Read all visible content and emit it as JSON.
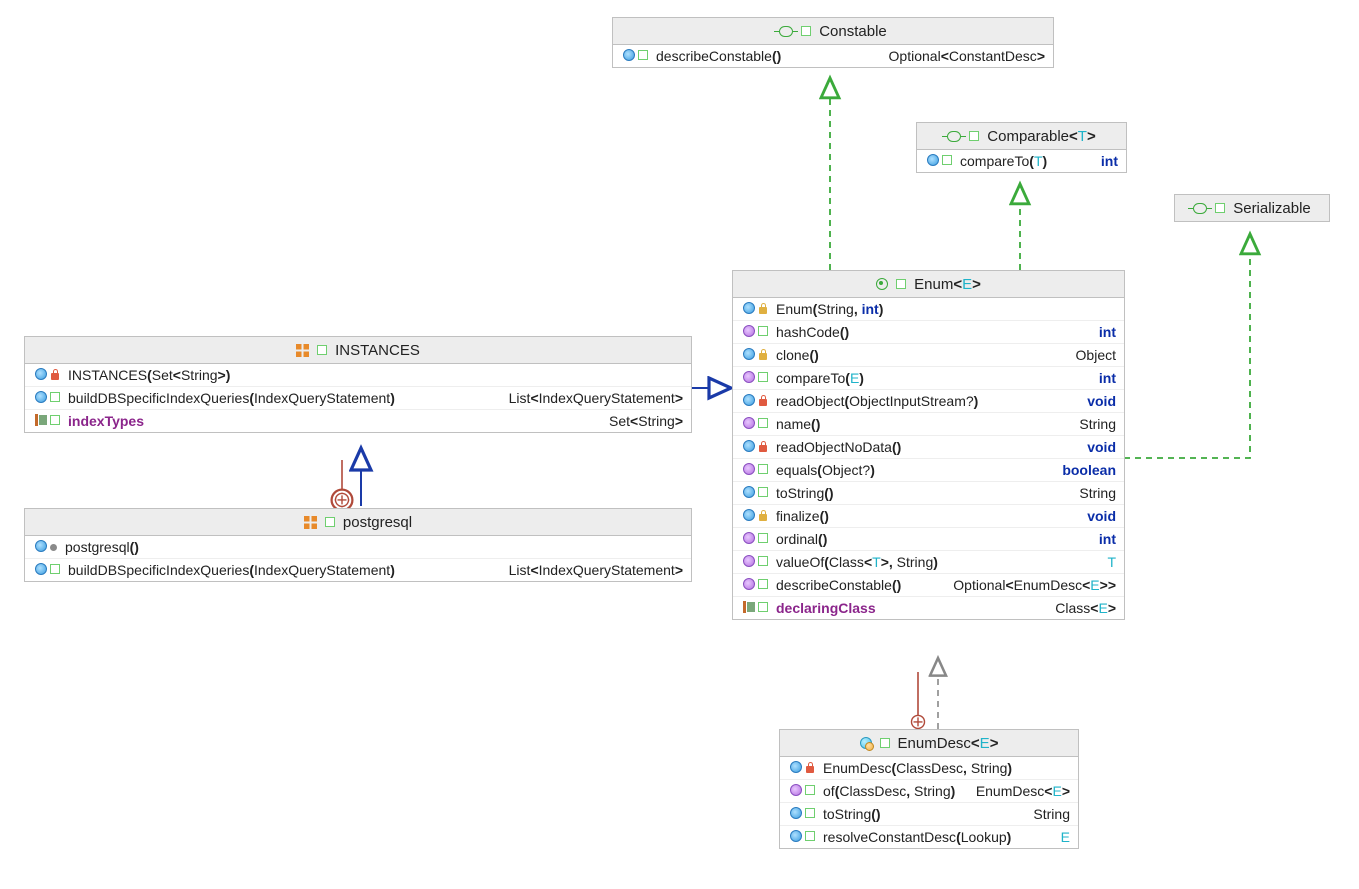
{
  "boxes": {
    "constable": {
      "title_html": "Constable",
      "members": [
        {
          "sig_html": "describeConstable<span class='punct'>()</span>",
          "ret_html": "Optional<span class='punct'>&lt;</span>ConstantDesc<span class='punct'>&gt;</span>"
        }
      ]
    },
    "comparable": {
      "title_html": "Comparable<span class='punct'>&lt;</span><span class='type-generic'>T</span><span class='punct'>&gt;</span>",
      "members": [
        {
          "sig_html": "compareTo<span class='punct'>(</span><span class='type-generic'>T</span><span class='punct'>)</span>",
          "ret_html": "<span class='kw'>int</span>"
        }
      ]
    },
    "serializable": {
      "title_html": "Serializable"
    },
    "enum": {
      "title_html": "Enum<span class='punct'>&lt;</span><span class='type-generic'>E</span><span class='punct'>&gt;</span>",
      "members": [
        {
          "icons": [
            "method-blue",
            "lock-yellow"
          ],
          "sig_html": "Enum<span class='punct'>(</span>String<span class='punct'>,</span> <span class='kw'>int</span><span class='punct'>)</span>",
          "ret_html": ""
        },
        {
          "icons": [
            "method-purple",
            "open"
          ],
          "sig_html": "hashCode<span class='punct'>()</span>",
          "ret_html": "<span class='kw'>int</span>"
        },
        {
          "icons": [
            "method-blue",
            "lock-yellow"
          ],
          "sig_html": "clone<span class='punct'>()</span>",
          "ret_html": "Object"
        },
        {
          "icons": [
            "method-purple",
            "open"
          ],
          "sig_html": "compareTo<span class='punct'>(</span><span class='type-generic'>E</span><span class='punct'>)</span>",
          "ret_html": "<span class='kw'>int</span>"
        },
        {
          "icons": [
            "method-blue",
            "lock"
          ],
          "sig_html": "readObject<span class='punct'>(</span>ObjectInputStream?<span class='punct'>)</span>",
          "ret_html": "<span class='kw'>void</span>"
        },
        {
          "icons": [
            "method-purple",
            "open"
          ],
          "sig_html": "name<span class='punct'>()</span>",
          "ret_html": "String"
        },
        {
          "icons": [
            "method-blue",
            "lock"
          ],
          "sig_html": "readObjectNoData<span class='punct'>()</span>",
          "ret_html": "<span class='kw'>void</span>"
        },
        {
          "icons": [
            "method-purple",
            "open"
          ],
          "sig_html": "equals<span class='punct'>(</span>Object?<span class='punct'>)</span>",
          "ret_html": "<span class='kw'>boolean</span>"
        },
        {
          "icons": [
            "method-blue",
            "open"
          ],
          "sig_html": "toString<span class='punct'>()</span>",
          "ret_html": "String"
        },
        {
          "icons": [
            "method-blue",
            "lock-yellow"
          ],
          "sig_html": "finalize<span class='punct'>()</span>",
          "ret_html": "<span class='kw'>void</span>"
        },
        {
          "icons": [
            "method-purple",
            "open"
          ],
          "sig_html": "ordinal<span class='punct'>()</span>",
          "ret_html": "<span class='kw'>int</span>"
        },
        {
          "icons": [
            "method-purple",
            "open"
          ],
          "sig_html": "valueOf<span class='punct'>(</span>Class<span class='punct'>&lt;</span><span class='type-generic'>T</span><span class='punct'>&gt;,</span> String<span class='punct'>)</span>",
          "ret_html": "<span class='type-generic'>T</span>"
        },
        {
          "icons": [
            "method-purple",
            "open"
          ],
          "sig_html": "describeConstable<span class='punct'>()</span>",
          "ret_html": "Optional<span class='punct'>&lt;</span>EnumDesc<span class='punct'>&lt;</span><span class='type-generic'>E</span><span class='punct'>&gt;&gt;</span>"
        },
        {
          "icons": [
            "prop",
            "open"
          ],
          "sig_html": "<span class='purple'>declaringClass</span>",
          "ret_html": "Class<span class='punct'>&lt;</span><span class='type-generic'>E</span><span class='punct'>&gt;</span>"
        }
      ]
    },
    "instances": {
      "title_html": "INSTANCES",
      "members": [
        {
          "icons": [
            "method-blue",
            "lock"
          ],
          "sig_html": "INSTANCES<span class='punct'>(</span>Set<span class='punct'>&lt;</span>String<span class='punct'>&gt;)</span>",
          "ret_html": ""
        },
        {
          "icons": [
            "method-blue",
            "open"
          ],
          "sig_html": "buildDBSpecificIndexQueries<span class='punct'>(</span>IndexQueryStatement<span class='punct'>)</span>",
          "ret_html": "List<span class='punct'>&lt;</span>IndexQueryStatement<span class='punct'>&gt;</span>"
        },
        {
          "icons": [
            "prop",
            "open"
          ],
          "sig_html": "<span class='purple'>indexTypes</span>",
          "ret_html": "Set<span class='punct'>&lt;</span>String<span class='punct'>&gt;</span>"
        }
      ]
    },
    "postgresql": {
      "title_html": "postgresql",
      "members": [
        {
          "icons": [
            "method-blue",
            "dot-gray"
          ],
          "sig_html": "postgresql<span class='punct'>()</span>",
          "ret_html": ""
        },
        {
          "icons": [
            "method-blue",
            "open"
          ],
          "sig_html": "buildDBSpecificIndexQueries<span class='punct'>(</span>IndexQueryStatement<span class='punct'>)</span>",
          "ret_html": "List<span class='punct'>&lt;</span>IndexQueryStatement<span class='punct'>&gt;</span>"
        }
      ]
    },
    "enumdesc": {
      "title_html": "EnumDesc<span class='punct'>&lt;</span><span class='type-generic'>E</span><span class='punct'>&gt;</span>",
      "members": [
        {
          "icons": [
            "method-blue",
            "lock"
          ],
          "sig_html": "EnumDesc<span class='punct'>(</span>ClassDesc<span class='punct'>,</span> String<span class='punct'>)</span>",
          "ret_html": ""
        },
        {
          "icons": [
            "method-purple",
            "open"
          ],
          "sig_html": "of<span class='punct'>(</span>ClassDesc<span class='punct'>,</span> String<span class='punct'>)</span>",
          "ret_html": "EnumDesc<span class='punct'>&lt;</span><span class='type-generic'>E</span><span class='punct'>&gt;</span>"
        },
        {
          "icons": [
            "method-blue",
            "open"
          ],
          "sig_html": "toString<span class='punct'>()</span>",
          "ret_html": "String"
        },
        {
          "icons": [
            "method-blue",
            "open"
          ],
          "sig_html": "resolveConstantDesc<span class='punct'>(</span>Lookup<span class='punct'>)</span>",
          "ret_html": "<span class='type-generic'>E</span>"
        }
      ]
    }
  }
}
